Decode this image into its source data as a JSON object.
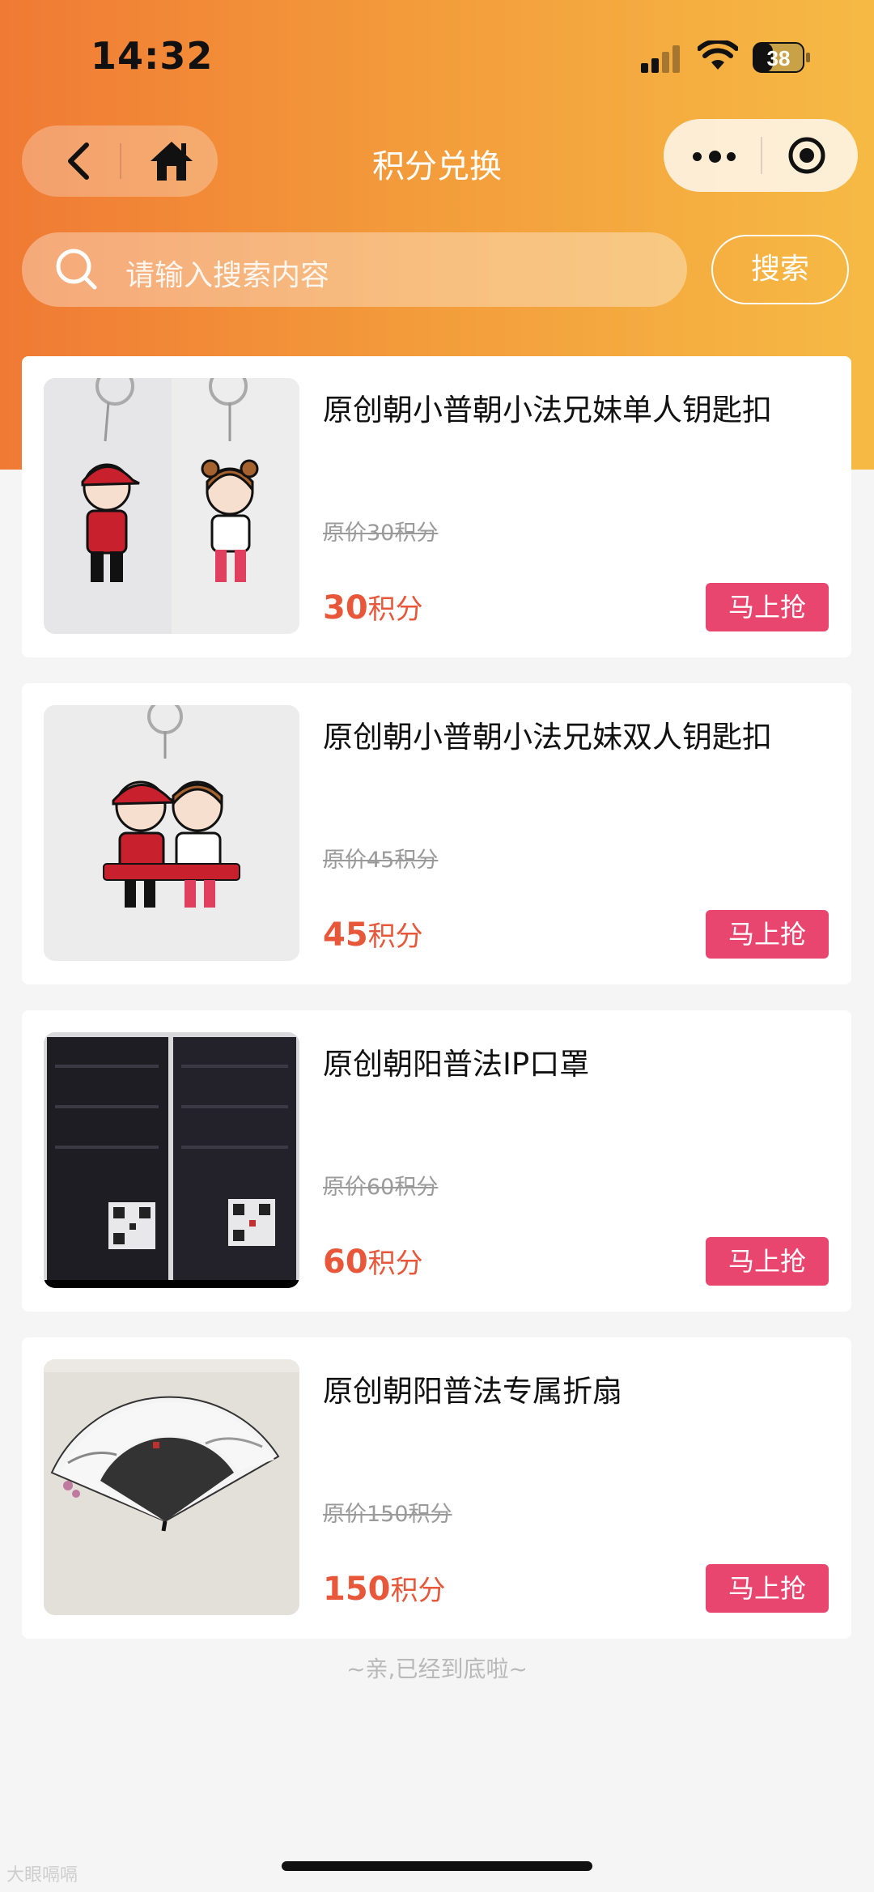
{
  "status_bar": {
    "time": "14:32",
    "battery": "38"
  },
  "nav": {
    "title": "积分兑换"
  },
  "search": {
    "placeholder": "请输入搜索内容",
    "button_label": "搜索"
  },
  "products": [
    {
      "name": "原创朝小普朝小法兄妹单人钥匙扣",
      "original_price": "原价30积分",
      "price": "30",
      "unit": "积分",
      "buy_label": "马上抢"
    },
    {
      "name": "原创朝小普朝小法兄妹双人钥匙扣",
      "original_price": "原价45积分",
      "price": "45",
      "unit": "积分",
      "buy_label": "马上抢"
    },
    {
      "name": "原创朝阳普法IP口罩",
      "original_price": "原价60积分",
      "price": "60",
      "unit": "积分",
      "buy_label": "马上抢"
    },
    {
      "name": "原创朝阳普法专属折扇",
      "original_price": "原价150积分",
      "price": "150",
      "unit": "积分",
      "buy_label": "马上抢"
    }
  ],
  "footer": {
    "end_text": "~亲,已经到底啦~",
    "watermark": "大眼嗝嗝"
  },
  "colors": {
    "accent": "#e8573a",
    "buy_button": "#e8466f",
    "header_start": "#f07a34",
    "header_end": "#f6ba44"
  }
}
